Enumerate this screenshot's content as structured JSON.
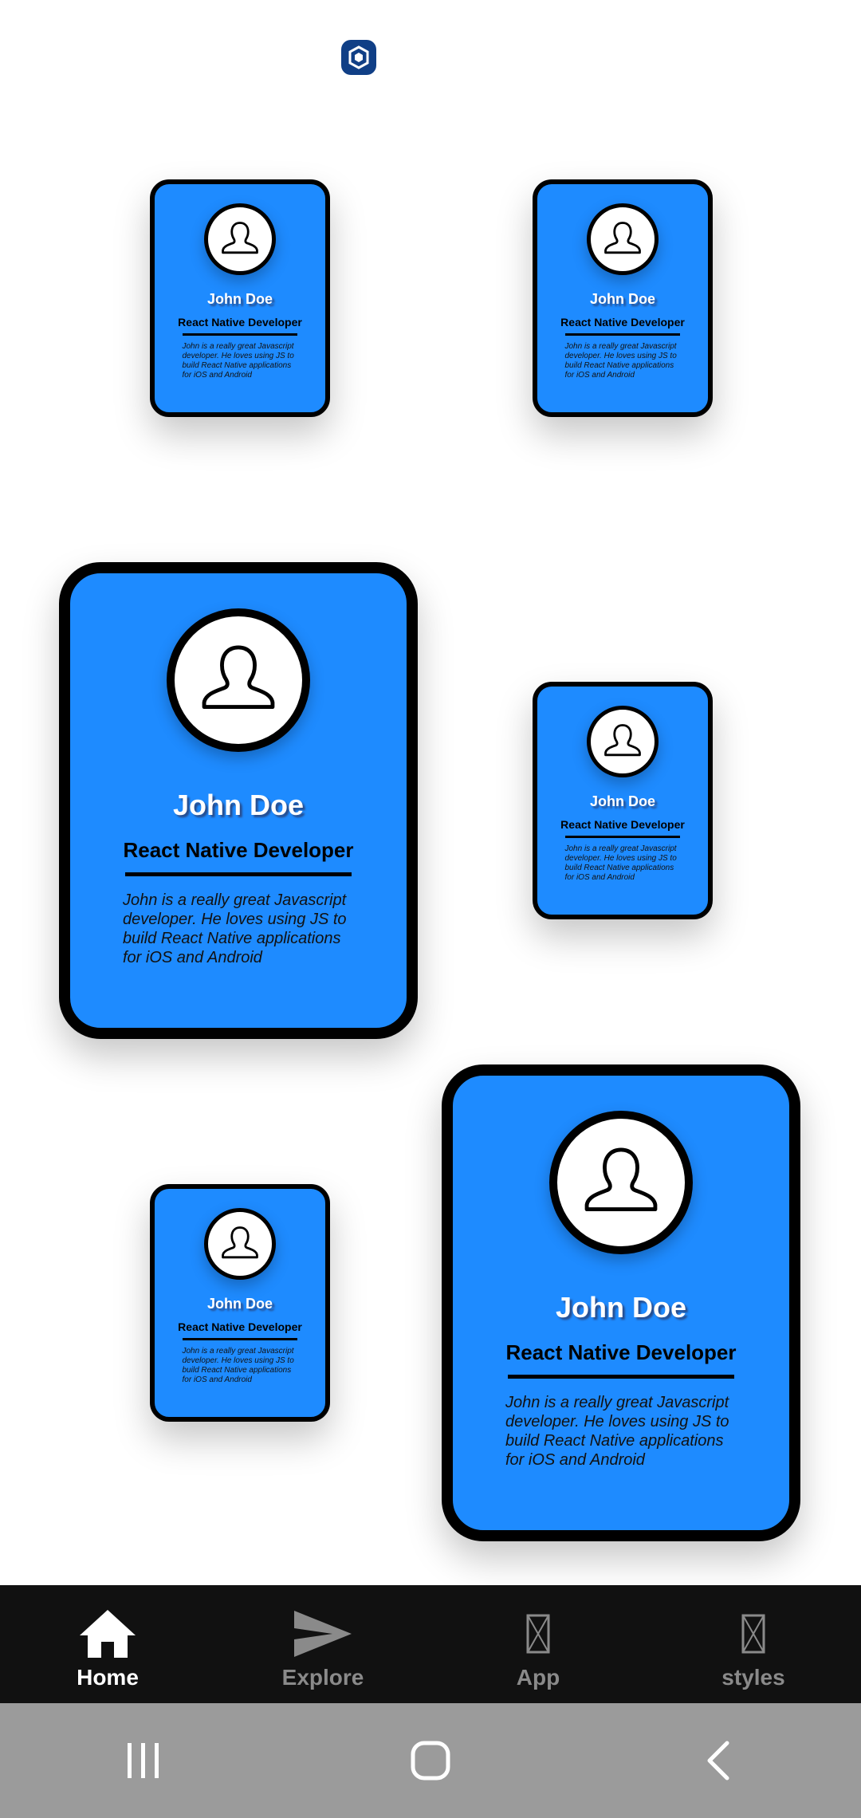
{
  "status": {
    "logo_icon": "crypto-logo-icon"
  },
  "profile": {
    "name": "John Doe",
    "role": "React Native Developer",
    "bio": "John is a really great Javascript developer. He loves using JS to build React Native applications for iOS and Android",
    "avatar_icon": "user-silhouette-icon"
  },
  "cards": [
    {
      "name": "John Doe",
      "role": "React Native Developer",
      "bio": "John is a really great Javascript developer. He loves using JS to build React Native applications for iOS and Android",
      "size": "small"
    },
    {
      "name": "John Doe",
      "role": "React Native Developer",
      "bio": "John is a really great Javascript developer. He loves using JS to build React Native applications for iOS and Android",
      "size": "small"
    },
    {
      "name": "John Doe",
      "role": "React Native Developer",
      "bio": "John is a really great Javascript developer. He loves using JS to build React Native applications for iOS and Android",
      "size": "large"
    },
    {
      "name": "John Doe",
      "role": "React Native Developer",
      "bio": "John is a really great Javascript developer. He loves using JS to build React Native applications for iOS and Android",
      "size": "small"
    },
    {
      "name": "John Doe",
      "role": "React Native Developer",
      "bio": "John is a really great Javascript developer. He loves using JS to build React Native applications for iOS and Android",
      "size": "small"
    },
    {
      "name": "John Doe",
      "role": "React Native Developer",
      "bio": "John is a really great Javascript developer. He loves using JS to build React Native applications for iOS and Android",
      "size": "large"
    }
  ],
  "tabs": [
    {
      "label": "Home",
      "icon": "home-icon",
      "active": true
    },
    {
      "label": "Explore",
      "icon": "send-icon",
      "active": false
    },
    {
      "label": "App",
      "icon": "missing-glyph-icon",
      "active": false
    },
    {
      "label": "styles",
      "icon": "missing-glyph-icon",
      "active": false
    }
  ],
  "system_nav": {
    "recents_icon": "recents-icon",
    "home_icon": "home-circle-icon",
    "back_icon": "back-icon"
  },
  "colors": {
    "card_bg": "#1e8bff",
    "tabbar_bg": "#111111",
    "navbar_bg": "#9b9b9b",
    "active_tab": "#ffffff",
    "inactive_tab": "#8a8a8a"
  }
}
